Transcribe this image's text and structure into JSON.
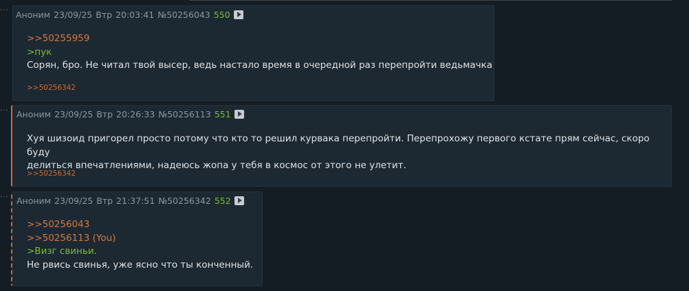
{
  "posts": [
    {
      "author": "Аноним",
      "date": "23/09/25",
      "weekday": "Втр",
      "time": "20:03:41",
      "post_id": "№50256043",
      "index": "550",
      "reply_links": [
        ">>50255959"
      ],
      "quotes": [
        ">пук"
      ],
      "text_lines": [
        "Сорян, бро. Не читал твой высер, ведь настало время в очередной раз перепройти ведьмачка"
      ],
      "replies": ">>50256342"
    },
    {
      "author": "Аноним",
      "date": "23/09/25",
      "weekday": "Втр",
      "time": "20:26:33",
      "post_id": "№50256113",
      "index": "551",
      "reply_links": [],
      "quotes": [],
      "text_lines": [
        "Хуя шизоид пригорел просто потому что кто то решил курвака перепройти. Перепрохожу первого кстате прям сейчас, скоро буду",
        "делиться впечатлениями, надеюсь жопа у тебя в космос от этого не улетит."
      ],
      "replies": ">>50256342"
    },
    {
      "author": "Аноним",
      "date": "23/09/25",
      "weekday": "Втр",
      "time": "21:37:51",
      "post_id": "№50256342",
      "index": "552",
      "reply_links": [
        ">>50256043",
        ">>50256113 (You)"
      ],
      "quotes": [
        ">Визг свиньи."
      ],
      "text_lines": [
        "Не рвись свинья, уже ясно что ты конченный."
      ],
      "replies": ""
    }
  ],
  "colors": {
    "background": "#141d24",
    "post_background": "#1c2832",
    "post_number": "#7fbf2d",
    "reply_link": "#d87a3a",
    "greentext": "#7fbf2d",
    "highlight_border": "#d36b2a"
  },
  "icons": {
    "expand": "play-arrow-icon"
  }
}
